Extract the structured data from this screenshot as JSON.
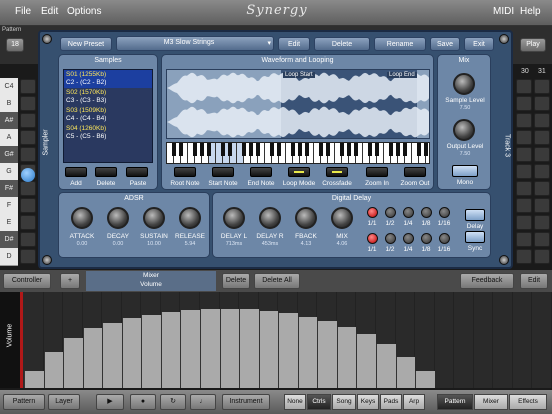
{
  "menubar": {
    "file": "File",
    "edit": "Edit",
    "options": "Options",
    "logo": "Synergy",
    "midi": "MIDI",
    "help": "Help"
  },
  "toprow": {
    "pattern_label": "Pattern",
    "number": "18",
    "play": "Play",
    "col30": "30",
    "col31": "31"
  },
  "notes": [
    "C4",
    "B",
    "A#",
    "A",
    "G#",
    "G",
    "F#",
    "F",
    "E",
    "D#",
    "D"
  ],
  "sampler": {
    "side_label": "Sampler",
    "track_label": "Track 3",
    "new_preset": "New Preset",
    "preset_name": "M3 Slow Strings",
    "edit": "Edit",
    "delete": "Delete",
    "rename": "Rename",
    "save": "Save",
    "exit": "Exit",
    "samples_title": "Samples",
    "samples": [
      {
        "name": "S01 (1255Kb)",
        "range": "C2 - (C2 - B2)"
      },
      {
        "name": "S02 (1570Kb)",
        "range": "C3 - (C3 - B3)"
      },
      {
        "name": "S03 (1509Kb)",
        "range": "C4 - (C4 - B4)"
      },
      {
        "name": "S04 (1260Kb)",
        "range": "C5 - (C5 - B6)"
      }
    ],
    "sample_buttons": [
      "Add",
      "Delete",
      "Paste"
    ],
    "wave_title": "Waveform and Looping",
    "loop_start": "Loop Start",
    "loop_end": "Loop End",
    "wave_buttons": [
      "Root Note",
      "Start Note",
      "End Note",
      "Loop Mode",
      "Crossfade",
      "Zoom In",
      "Zoom Out"
    ],
    "mix_title": "Mix",
    "sample_level_label": "Sample Level",
    "sample_level_value": "7.50",
    "output_level_label": "Output Level",
    "output_level_value": "7.50",
    "mono": "Mono",
    "adsr_title": "ADSR",
    "adsr": [
      {
        "label": "ATTACK",
        "value": "0.00"
      },
      {
        "label": "DECAY",
        "value": "0.00"
      },
      {
        "label": "SUSTAIN",
        "value": "10.00"
      },
      {
        "label": "RELEASE",
        "value": "5.94"
      }
    ],
    "delay_title": "Digital Delay",
    "delay_knobs": [
      {
        "label": "DELAY L",
        "value": "713ms"
      },
      {
        "label": "DELAY R",
        "value": "453ms"
      },
      {
        "label": "FBACK",
        "value": "4.13"
      },
      {
        "label": "MIX",
        "value": "4.06"
      }
    ],
    "delay_leds": [
      "1/1",
      "1/2",
      "1/4",
      "1/8",
      "1/16"
    ],
    "delay_btn": "Delay",
    "sync_btn": "Sync"
  },
  "ctrlbar": {
    "controller": "Controller",
    "plus": "+",
    "mixer": "Mixer",
    "volume": "Volume",
    "delete": "Delete",
    "delete_all": "Delete All",
    "feedback": "Feedback",
    "edit": "Edit"
  },
  "vol_label": "Volume",
  "vol_values": [
    0.18,
    0.38,
    0.52,
    0.62,
    0.68,
    0.73,
    0.76,
    0.79,
    0.81,
    0.82,
    0.82,
    0.82,
    0.8,
    0.78,
    0.74,
    0.7,
    0.64,
    0.56,
    0.46,
    0.32,
    0.18,
    0,
    0,
    0,
    0,
    0,
    0
  ],
  "bottombar": {
    "pattern": "Pattern",
    "layer": "Layer",
    "instrument": "Instrument",
    "segs1": [
      "None",
      "Ctrls",
      "Song",
      "Keys",
      "Pads",
      "Arp"
    ],
    "segs2": [
      "Pattern",
      "Mixer",
      "Effects"
    ]
  }
}
